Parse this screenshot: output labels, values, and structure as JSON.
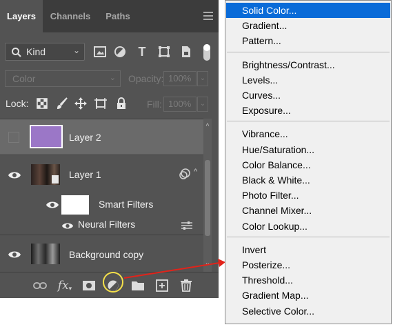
{
  "tabs": [
    {
      "label": "Layers",
      "active": true
    },
    {
      "label": "Channels",
      "active": false
    },
    {
      "label": "Paths",
      "active": false
    }
  ],
  "filter": {
    "kind_label": "Kind"
  },
  "blend": {
    "mode": "Color",
    "opacity_label": "Opacity:",
    "opacity_value": "100%"
  },
  "lock": {
    "label": "Lock:",
    "fill_label": "Fill:",
    "fill_value": "100%"
  },
  "layers": [
    {
      "name": "Layer 2",
      "visible": false,
      "selected": true,
      "thumb_color": "#9b77c7"
    },
    {
      "name": "Layer 1",
      "visible": true,
      "selected": false
    },
    {
      "name": "Smart Filters",
      "visible": true,
      "thumb_color": "#ffffff"
    },
    {
      "name": "Neural Filters",
      "visible": true
    },
    {
      "name": "Background copy",
      "visible": true
    }
  ],
  "menu": {
    "highlighted": "Solid Color...",
    "groups": [
      [
        "Solid Color...",
        "Gradient...",
        "Pattern..."
      ],
      [
        "Brightness/Contrast...",
        "Levels...",
        "Curves...",
        "Exposure..."
      ],
      [
        "Vibrance...",
        "Hue/Saturation...",
        "Color Balance...",
        "Black & White...",
        "Photo Filter...",
        "Channel Mixer...",
        "Color Lookup..."
      ],
      [
        "Invert",
        "Posterize...",
        "Threshold...",
        "Gradient Map...",
        "Selective Color..."
      ]
    ]
  },
  "bottom_icons": [
    "link-icon",
    "fx-icon",
    "mask-icon",
    "adjustment-layer-icon",
    "folder-icon",
    "new-layer-icon",
    "trash-icon"
  ],
  "fx_label": "fx",
  "colors": {
    "panel_bg": "#535353",
    "tabbar_bg": "#3c3c3c",
    "selected_row": "#6a6a6a",
    "menu_highlight": "#0a6bd8",
    "annotation_arrow": "#e2231a",
    "annotation_ring": "#f5e04a"
  }
}
